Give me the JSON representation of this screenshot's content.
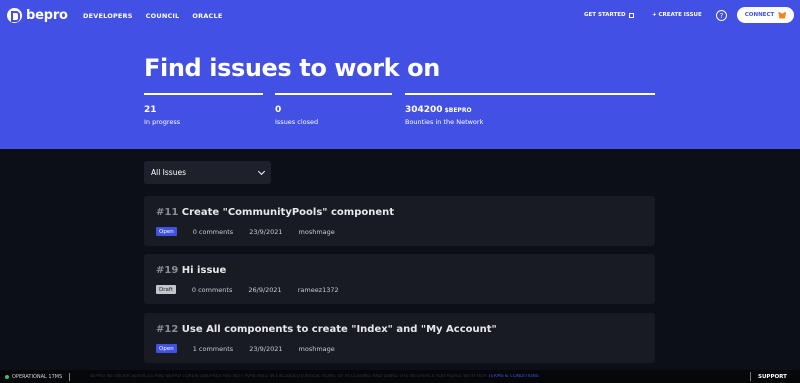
{
  "brand": {
    "name": "bepro"
  },
  "nav": {
    "items": [
      "DEVELOPERS",
      "COUNCIL",
      "ORACLE"
    ]
  },
  "header_right": {
    "get_started": "GET STARTED",
    "create_issue": "+ CREATE ISSUE",
    "help": "?",
    "connect": "CONNECT"
  },
  "hero": {
    "title": "Find issues to work on",
    "stats": [
      {
        "value": "21",
        "unit": "",
        "label": "In progress"
      },
      {
        "value": "0",
        "unit": "",
        "label": "Issues closed"
      },
      {
        "value": "304200",
        "unit": "$BEPRO",
        "label": "Bounties in the Network"
      }
    ]
  },
  "filter": {
    "selected": "All Issues"
  },
  "issues": [
    {
      "number": "#11",
      "title": "Create \"CommunityPools\" component",
      "status": "Open",
      "comments": "0 comments",
      "date": "23/9/2021",
      "author": "moshmage"
    },
    {
      "number": "#19",
      "title": "Hi issue",
      "status": "Draft",
      "comments": "0 comments",
      "date": "26/9/2021",
      "author": "rameez1372"
    },
    {
      "number": "#12",
      "title": "Use All components to create \"Index\" and \"My Account\"",
      "status": "Open",
      "comments": "1 comments",
      "date": "23/9/2021",
      "author": "moshmage"
    }
  ],
  "statusbar": {
    "operational": "OPERATIONAL 17MS",
    "disclaimer": "BEPRO NETWORK SERVICES AND BEPRO TOKEN ($BEPRO) ARE NOT AVAILABLE IN EXCLUDED JURISDICTIONS. BY ACCESSING AND USING THE INTERFACE YOU AGREE WITH OUR",
    "terms": "TERMS & CONDITIONS",
    "support": "SUPPORT"
  },
  "colors": {
    "primary": "#4250e4",
    "background": "#0d0f16",
    "card": "#191b23",
    "operational": "#33c56e"
  }
}
